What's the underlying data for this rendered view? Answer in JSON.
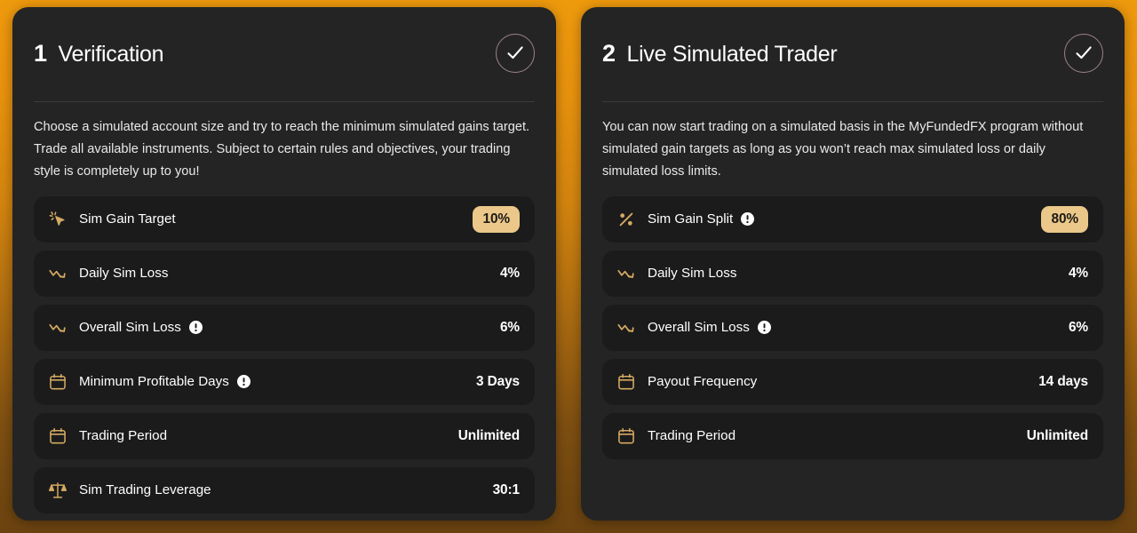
{
  "theme": {
    "background_top": "#ef9a0d",
    "background_bottom": "#6b4310",
    "card_bg": "#242424",
    "row_bg": "#1b1b1b",
    "accent_gold": "#d4aa62",
    "badge_bg": "#ebc88a",
    "badge_text": "#1d1a15",
    "text_primary": "#ffffff"
  },
  "cards": [
    {
      "step_number": "1",
      "title": "Verification",
      "status_icon": "check-circle-icon",
      "description": "Choose a simulated account size and try to reach the minimum simulated gains target. Trade all available instruments. Subject to certain rules and objectives, your trading style is completely up to you!",
      "rows": [
        {
          "icon": "cursor-click-sparkle-icon",
          "label": "Sim Gain Target",
          "info": false,
          "value": "10%",
          "highlight": true
        },
        {
          "icon": "trend-down-icon",
          "label": "Daily Sim Loss",
          "info": false,
          "value": "4%",
          "highlight": false
        },
        {
          "icon": "trend-down-icon",
          "label": "Overall Sim Loss",
          "info": true,
          "value": "6%",
          "highlight": false
        },
        {
          "icon": "calendar-icon",
          "label": "Minimum Profitable Days",
          "info": true,
          "value": "3 Days",
          "highlight": false
        },
        {
          "icon": "calendar-icon",
          "label": "Trading Period",
          "info": false,
          "value": "Unlimited",
          "highlight": false
        },
        {
          "icon": "scales-balance-icon",
          "label": "Sim Trading Leverage",
          "info": false,
          "value": "30:1",
          "highlight": false
        }
      ]
    },
    {
      "step_number": "2",
      "title": "Live Simulated Trader",
      "status_icon": "check-circle-icon",
      "description": "You can now start trading on a simulated basis in the MyFundedFX program without simulated gain targets as long as you won’t reach max simulated loss or daily simulated loss limits.",
      "rows": [
        {
          "icon": "percent-icon",
          "label": "Sim Gain Split",
          "info": true,
          "value": "80%",
          "highlight": true
        },
        {
          "icon": "trend-down-icon",
          "label": "Daily Sim Loss",
          "info": false,
          "value": "4%",
          "highlight": false
        },
        {
          "icon": "trend-down-icon",
          "label": "Overall Sim Loss",
          "info": true,
          "value": "6%",
          "highlight": false
        },
        {
          "icon": "calendar-icon",
          "label": "Payout Frequency",
          "info": false,
          "value": "14 days",
          "highlight": false
        },
        {
          "icon": "calendar-icon",
          "label": "Trading Period",
          "info": false,
          "value": "Unlimited",
          "highlight": false
        }
      ]
    }
  ]
}
